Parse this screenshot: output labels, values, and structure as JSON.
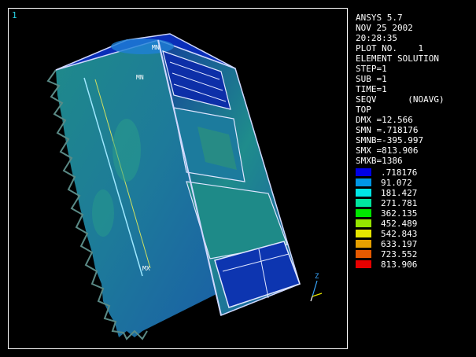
{
  "window": {
    "number": "1"
  },
  "info": [
    "ANSYS 5.7",
    "NOV 25 2002",
    "20:28:35",
    "PLOT NO.    1",
    "ELEMENT SOLUTION",
    "STEP=1",
    "SUB =1",
    "TIME=1",
    "SEQV      (NOAVG)",
    "TOP",
    "DMX =12.566",
    "SMN =.718176",
    "SMNB=-395.997",
    "SMX =813.906",
    "SMXB=1386"
  ],
  "legend": [
    {
      "value": ".718176",
      "color": "#0000e6"
    },
    {
      "value": "91.072",
      "color": "#0096e6"
    },
    {
      "value": "181.427",
      "color": "#00e6e6"
    },
    {
      "value": "271.781",
      "color": "#00e6a0"
    },
    {
      "value": "362.135",
      "color": "#00e600"
    },
    {
      "value": "452.489",
      "color": "#96e600"
    },
    {
      "value": "542.843",
      "color": "#e6e600"
    },
    {
      "value": "633.197",
      "color": "#e6a000"
    },
    {
      "value": "723.552",
      "color": "#e65a00"
    },
    {
      "value": "813.906",
      "color": "#e60000"
    }
  ],
  "markers": {
    "mn": "MN",
    "mx": "MX",
    "top": "MN"
  },
  "axes": {
    "z": "Z"
  }
}
